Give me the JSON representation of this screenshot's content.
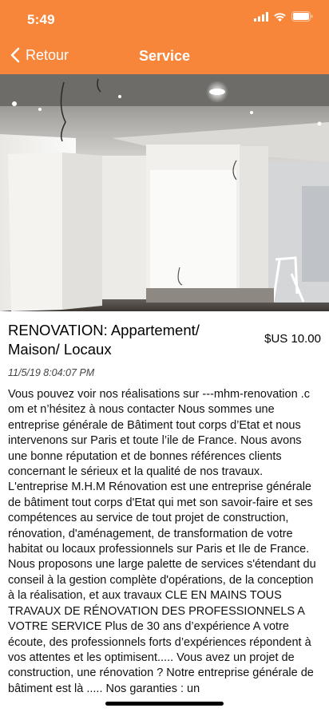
{
  "status_bar": {
    "time": "5:49"
  },
  "nav": {
    "back_label": "Retour",
    "title": "Service"
  },
  "colors": {
    "accent": "#f7863a"
  },
  "icons": {
    "back": "chevron-left-icon",
    "signal": "signal-icon",
    "wifi": "wifi-icon",
    "battery": "battery-icon"
  },
  "listing": {
    "title": "RENOVATION: Appartement/ Maison/ Locaux",
    "price": "$US 10.00",
    "date": "11/5/19 8:04:07 PM",
    "description": "Vous pouvez voir nos réalisations sur ---mhm-renovation .c om et n’hésitez à nous contacter Nous sommes une entreprise générale de Bâtiment tout corps d’Etat et nous intervenons sur Paris et toute l’ile de France. Nous avons une bonne réputation et de bonnes références clients concernant le sérieux et la qualité de nos travaux. L'entreprise M.H.M Rénovation est une entreprise générale de bâtiment tout corps d'Etat qui met son savoir-faire et ses compétences au service de tout projet de construction, rénovation, d'aménagement, de transformation de votre habitat ou locaux professionnels sur Paris et Ile de France. Nous proposons une large palette de services s'étendant du conseil à la gestion complète d'opérations, de la conception à la réalisation, et aux travaux  CLE EN MAINS  TOUS TRAVAUX DE RÉNOVATION DES PROFESSIONNELS A VOTRE SERVICE Plus de 30 ans d’expérience A votre écoute, des professionnels forts d’expériences répondent à vos attentes et les optimisent..... Vous avez un projet de construction, une rénovation ? Notre entreprise générale de bâtiment est là ..... Nos garanties : un"
  }
}
